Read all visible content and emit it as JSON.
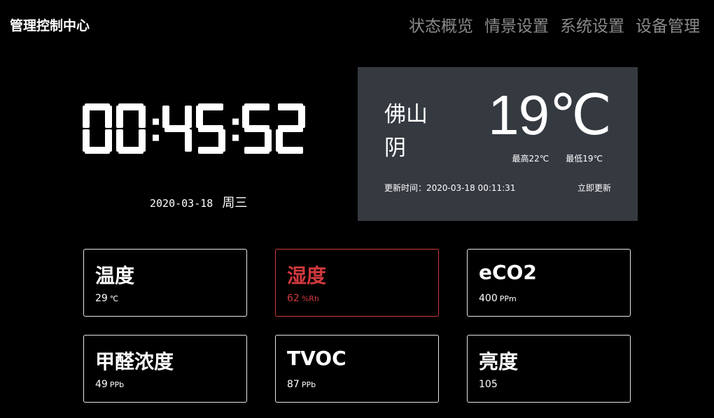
{
  "app": {
    "title": "管理控制中心"
  },
  "nav": {
    "items": [
      "状态概览",
      "情景设置",
      "系统设置",
      "设备管理"
    ]
  },
  "clock": {
    "time": "00:45:52",
    "date": "2020-03-18",
    "weekday": "周三"
  },
  "weather": {
    "city": "佛山",
    "condition": "阴",
    "temperature": "19℃",
    "high": "最高22℃",
    "low": "最低19℃",
    "update_time": "更新时间：2020-03-18 00:11:31",
    "refresh_label": "立即更新"
  },
  "sensors": [
    {
      "label": "温度",
      "value": "29",
      "unit": "℃"
    },
    {
      "label": "湿度",
      "value": "62",
      "unit": "%Rh"
    },
    {
      "label": "eCO2",
      "value": "400",
      "unit": "PPm"
    },
    {
      "label": "甲醛浓度",
      "value": "49",
      "unit": "PPb"
    },
    {
      "label": "TVOC",
      "value": "87",
      "unit": "PPb"
    },
    {
      "label": "亮度",
      "value": "105",
      "unit": ""
    }
  ],
  "colors": {
    "background": "#000000",
    "panel": "#353940",
    "active": "#d0393e",
    "nav_text": "#8a8a8a"
  }
}
